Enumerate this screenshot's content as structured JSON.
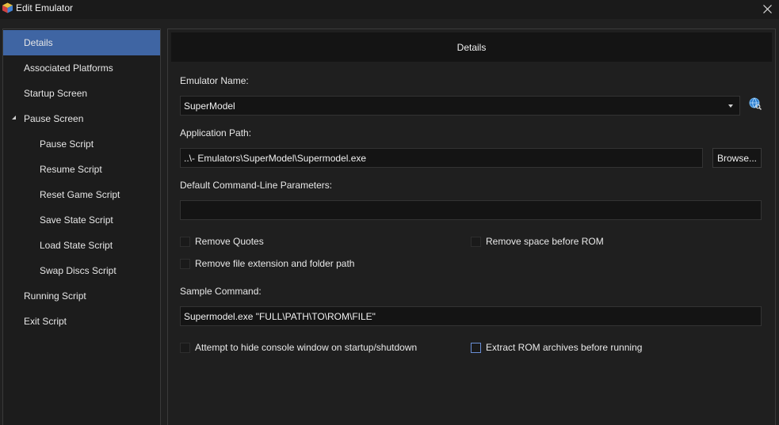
{
  "window": {
    "title": "Edit Emulator",
    "app_icon": "cube-icon",
    "close_icon": "close-icon"
  },
  "sidebar": {
    "items": [
      {
        "label": "Details",
        "active": true
      },
      {
        "label": "Associated Platforms"
      },
      {
        "label": "Startup Screen"
      },
      {
        "label": "Pause Screen",
        "expanded": true
      },
      {
        "label": "Pause Script"
      },
      {
        "label": "Resume Script"
      },
      {
        "label": "Reset Game Script"
      },
      {
        "label": "Save State Script"
      },
      {
        "label": "Load State Script"
      },
      {
        "label": "Swap Discs Script"
      },
      {
        "label": "Running Script"
      },
      {
        "label": "Exit Script"
      }
    ]
  },
  "main": {
    "header": "Details",
    "emulator_name_label": "Emulator Name:",
    "emulator_name_value": "SuperModel",
    "app_path_label": "Application Path:",
    "app_path_value": "..\\- Emulators\\SuperModel\\Supermodel.exe",
    "browse_label": "Browse...",
    "cmd_params_label": "Default Command-Line Parameters:",
    "cmd_params_value": "",
    "remove_quotes": {
      "label": "Remove Quotes",
      "checked": false
    },
    "remove_space": {
      "label": "Remove space before ROM",
      "checked": false
    },
    "remove_ext": {
      "label": "Remove file extension and folder path",
      "checked": false
    },
    "sample_cmd_label": "Sample Command:",
    "sample_cmd_value": "Supermodel.exe \"FULL\\PATH\\TO\\ROM\\FILE\"",
    "hide_console": {
      "label": "Attempt to hide console window on startup/shutdown",
      "checked": false
    },
    "extract_rom": {
      "label": "Extract ROM archives before running",
      "checked": false
    },
    "globe_icon": "globe-search-icon"
  },
  "colors": {
    "accent": "#3f65a3",
    "background": "#202020",
    "field": "#141414"
  }
}
